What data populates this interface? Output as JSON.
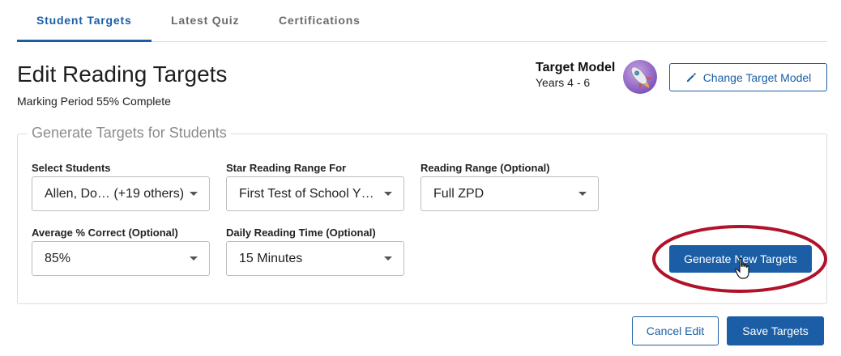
{
  "tabs": [
    {
      "label": "Student Targets",
      "active": true
    },
    {
      "label": "Latest Quiz",
      "active": false
    },
    {
      "label": "Certifications",
      "active": false
    }
  ],
  "header": {
    "title": "Edit Reading Targets",
    "subtitle": "Marking Period 55% Complete",
    "target_model_label": "Target Model",
    "target_model_years": "Years 4 - 6",
    "change_button": "Change Target Model",
    "change_icon": "pencil-icon"
  },
  "generate": {
    "legend": "Generate Targets for Students",
    "fields": {
      "students": {
        "label": "Select Students",
        "value": "Allen, Do…  (+19 others)"
      },
      "star_range": {
        "label": "Star Reading Range For",
        "value": "First Test of School Y…"
      },
      "reading_range": {
        "label": "Reading Range (Optional)",
        "value": "Full ZPD"
      },
      "avg_correct": {
        "label": "Average % Correct (Optional)",
        "value": "85%"
      },
      "daily_time": {
        "label": "Daily Reading Time (Optional)",
        "value": "15 Minutes"
      }
    },
    "generate_button": "Generate New Targets"
  },
  "footer": {
    "cancel_button": "Cancel Edit",
    "save_button": "Save Targets"
  },
  "colors": {
    "accent": "#1b5ea6",
    "highlight": "#b0122b"
  }
}
